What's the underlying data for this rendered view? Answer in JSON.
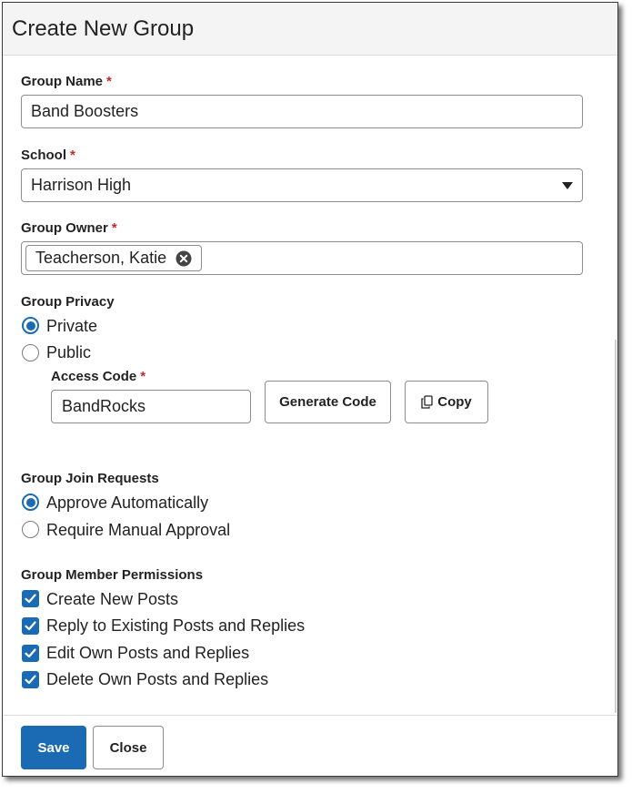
{
  "dialog": {
    "title": "Create New Group"
  },
  "group_name": {
    "label": "Group Name",
    "required": "*",
    "value": "Band Boosters"
  },
  "school": {
    "label": "School",
    "required": "*",
    "value": "Harrison High"
  },
  "group_owner": {
    "label": "Group Owner",
    "required": "*",
    "chip": "Teacherson, Katie"
  },
  "privacy": {
    "label": "Group Privacy",
    "options": [
      {
        "label": "Private",
        "selected": true
      },
      {
        "label": "Public",
        "selected": false
      }
    ],
    "access_code": {
      "label": "Access Code",
      "required": "*",
      "value": "BandRocks"
    },
    "generate_label": "Generate Code",
    "copy_label": "Copy"
  },
  "join_requests": {
    "label": "Group Join Requests",
    "options": [
      {
        "label": "Approve Automatically",
        "selected": true
      },
      {
        "label": "Require Manual Approval",
        "selected": false
      }
    ]
  },
  "permissions": {
    "label": "Group Member Permissions",
    "items": [
      {
        "label": "Create New Posts",
        "checked": true
      },
      {
        "label": "Reply to Existing Posts and Replies",
        "checked": true
      },
      {
        "label": "Edit Own Posts and Replies",
        "checked": true
      },
      {
        "label": "Delete Own Posts and Replies",
        "checked": true
      }
    ]
  },
  "footer": {
    "save_label": "Save",
    "close_label": "Close"
  },
  "colors": {
    "accent": "#1a6bb3",
    "required": "#c62828"
  },
  "icons": {
    "dropdown": "triangle-down-icon",
    "remove": "x-circle-icon",
    "copy": "copy-icon",
    "check": "checkmark-icon"
  }
}
